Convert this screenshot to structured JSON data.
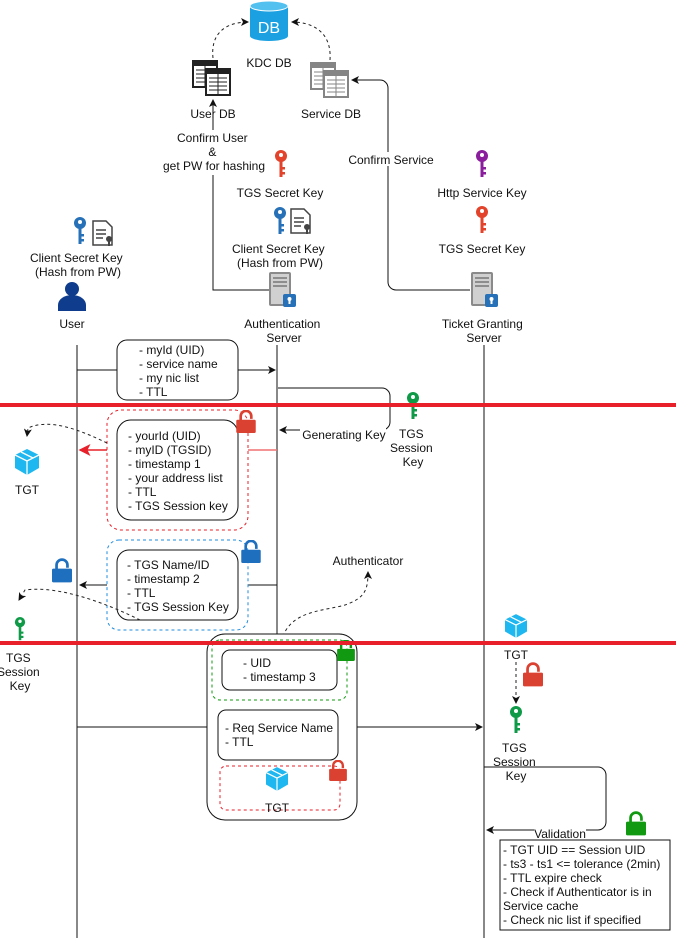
{
  "colors": {
    "red_line": "#e8202a",
    "db": "#1ba1e2",
    "tgt": "#1fb7ef",
    "lock_red": "#db4130",
    "lock_blue": "#1f6fbf",
    "lock_green": "#119a11",
    "key_red": "#e2432a",
    "key_blue": "#2771b8",
    "key_purple": "#8b1e9c",
    "key_green": "#0f9a48"
  },
  "kdc": {
    "db_icon_text": "DB",
    "label": "KDC DB",
    "user_db": "User DB",
    "service_db": "Service DB",
    "confirm_user": [
      "Confirm User",
      "&",
      "get PW for hashing"
    ],
    "confirm_service": "Confirm Service"
  },
  "auth_server": {
    "tgs_secret_key": "TGS Secret Key",
    "client_secret_key": [
      "Client Secret Key",
      "(Hash from PW)"
    ],
    "label": [
      "Authentication",
      "Server"
    ]
  },
  "tgs_server": {
    "http_service_key": "Http Service Key",
    "tgs_secret_key": "TGS Secret Key",
    "label": [
      "Ticket Granting",
      "Server"
    ]
  },
  "user": {
    "client_secret_key": [
      "Client Secret Key",
      "(Hash from PW)"
    ],
    "label": "User"
  },
  "messages": {
    "request": [
      "- myId (UID)",
      "- service name",
      "- my nic list",
      "- TTL"
    ],
    "generating_key": "Generating Key",
    "tgs_session_key": [
      "TGS",
      "Session",
      "Key"
    ],
    "tgt_reply": [
      "- yourId (UID)",
      "- myID (TGSID)",
      "- timestamp 1",
      "- your address list",
      "- TTL",
      "- TGS Session key"
    ],
    "tgt_label": "TGT",
    "session_reply": [
      "- TGS Name/ID",
      "- timestamp 2",
      "- TTL",
      "- TGS Session Key"
    ],
    "client_session_key": [
      "TGS",
      "Session",
      "Key"
    ],
    "authenticator": "Authenticator",
    "authenticator_content": [
      "- UID",
      "- timestamp 3"
    ],
    "service_request": [
      "- Req Service Name",
      "- TTL"
    ],
    "request_tgt_label": "TGT",
    "server_tgt_label": "TGT",
    "server_session_key": [
      "TGS",
      "Session",
      "Key"
    ],
    "validation": "Validation",
    "validation_checks": [
      "- TGT UID == Session UID",
      "- ts3 - ts1 <= tolerance (2min)",
      "- TTL expire check",
      "- Check if Authenticator is in",
      "Service cache",
      "- Check nic list if specified"
    ]
  }
}
